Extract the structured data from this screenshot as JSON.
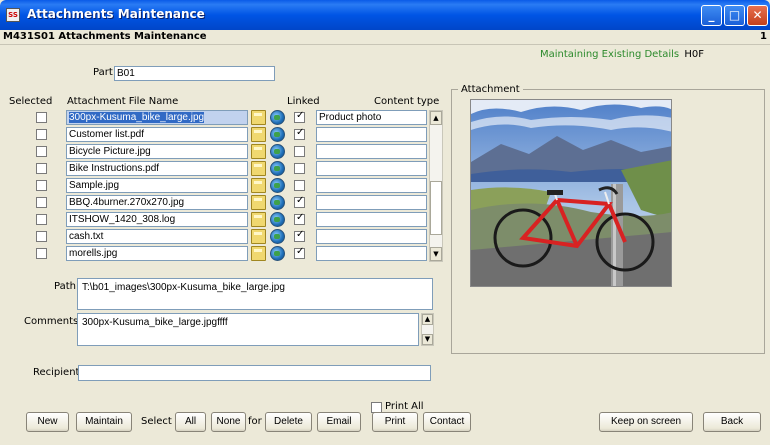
{
  "window": {
    "title": "Attachments Maintenance",
    "app_icon_text": "SS"
  },
  "subtitle": {
    "program": "M431S01 Attachments Maintenance",
    "page": "1"
  },
  "status": {
    "text": "Maintaining Existing Details",
    "code": "H0F"
  },
  "part": {
    "label": "Part",
    "value": "B01"
  },
  "columns": {
    "selected": "Selected",
    "file_name": "Attachment File Name",
    "linked": "Linked",
    "content_type": "Content type"
  },
  "rows": [
    {
      "file": "300px-Kusuma_bike_large.jpg",
      "linked": true,
      "content": "Product photo"
    },
    {
      "file": "Customer list.pdf",
      "linked": true,
      "content": ""
    },
    {
      "file": "Bicycle Picture.jpg",
      "linked": false,
      "content": ""
    },
    {
      "file": "Bike Instructions.pdf",
      "linked": false,
      "content": ""
    },
    {
      "file": "Sample.jpg",
      "linked": false,
      "content": ""
    },
    {
      "file": "BBQ.4burner.270x270.jpg",
      "linked": true,
      "content": ""
    },
    {
      "file": "ITSHOW_1420_308.log",
      "linked": true,
      "content": ""
    },
    {
      "file": "cash.txt",
      "linked": true,
      "content": ""
    },
    {
      "file": "morells.jpg",
      "linked": true,
      "content": ""
    }
  ],
  "path": {
    "label": "Path",
    "value": "T:\\b01_images\\300px-Kusuma_bike_large.jpg"
  },
  "comments": {
    "label": "Comments",
    "value": "300px-Kusuma_bike_large.jpgffff"
  },
  "recipient": {
    "label": "Recipient",
    "value": ""
  },
  "attachment_group": {
    "label": "Attachment"
  },
  "print_all": {
    "label": "Print All",
    "checked": false
  },
  "buttons": {
    "new": "New",
    "maintain": "Maintain",
    "select_label": "Select",
    "all": "All",
    "none": "None",
    "for_label": "for",
    "delete": "Delete",
    "email": "Email",
    "print": "Print",
    "contact": "Contact",
    "keep": "Keep on screen",
    "back": "Back"
  },
  "icons": {
    "folder": "folder-icon",
    "globe": "globe-icon"
  },
  "colors": {
    "title_blue": "#0055e5",
    "status_green": "#2c8a2c",
    "selection": "#316ac5"
  }
}
